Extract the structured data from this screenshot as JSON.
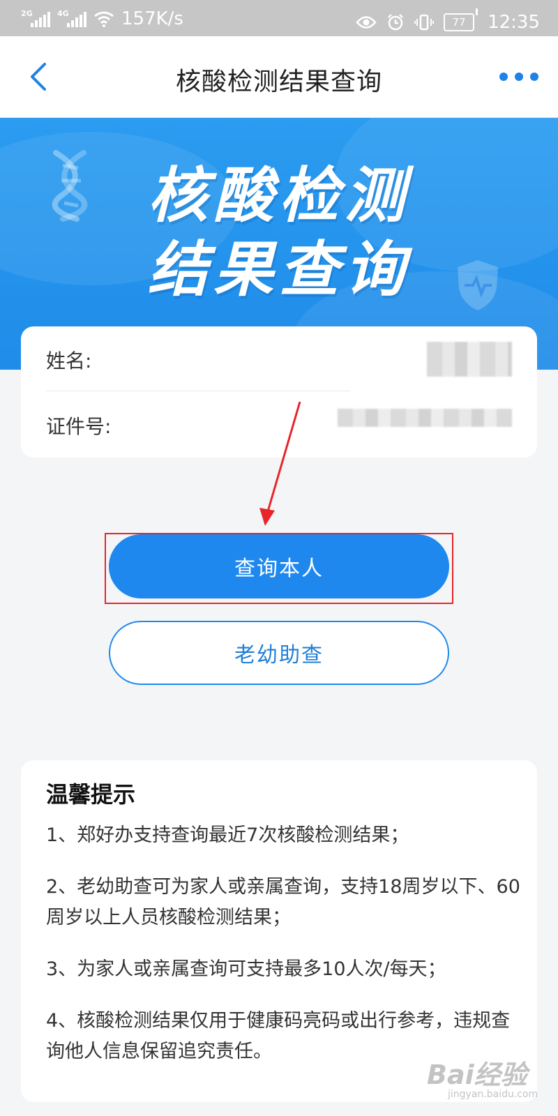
{
  "status_bar": {
    "net1": "2G",
    "net2": "4G",
    "speed": "157K/s",
    "battery": "77",
    "time": "12:35"
  },
  "nav": {
    "title": "核酸检测结果查询"
  },
  "banner": {
    "line1": "核酸检测",
    "line2": "结果查询"
  },
  "form": {
    "name_label": "姓名:",
    "id_label": "证件号:"
  },
  "buttons": {
    "query_self": "查询本人",
    "elder_child": "老幼助查"
  },
  "tips": {
    "title": "温馨提示",
    "items": [
      "1、郑好办支持查询最近7次核酸检测结果；",
      "2、老幼助查可为家人或亲属查询，支持18周岁以下、60周岁以上人员核酸检测结果；",
      "3、为家人或亲属查询可支持最多10人次/每天；",
      "4、核酸检测结果仅用于健康码亮码或出行参考，违规查询他人信息保留追究责任。"
    ]
  },
  "watermark": {
    "main": "Bai经验",
    "sub": "jingyan.baidu.com"
  },
  "colors": {
    "primary": "#1e88ee",
    "highlight": "#e8252a",
    "tip_underline": "#f7dd3e"
  }
}
